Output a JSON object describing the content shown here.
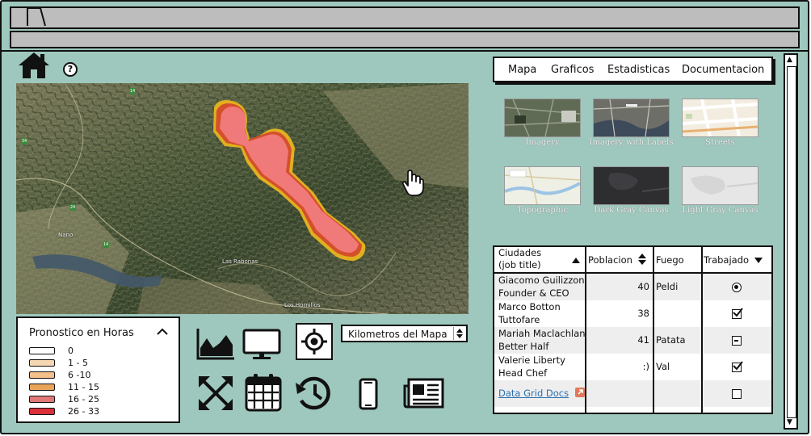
{
  "toolbar": {
    "help_label": "?"
  },
  "map": {
    "places": {
      "nano": "Nano",
      "las_rabonas": "Las Rabonas",
      "los_hornillos": "Los Hornillos"
    },
    "routes": {
      "r34": "34",
      "r14a": "14",
      "r14b": "14",
      "r24": "24"
    }
  },
  "legend": {
    "title": "Pronostico en Horas",
    "items": [
      {
        "label": "0",
        "color": "#ffffff"
      },
      {
        "label": "1 - 5",
        "color": "#f6d7b4"
      },
      {
        "label": "6 -10",
        "color": "#f4c08a"
      },
      {
        "label": "11 - 15",
        "color": "#e8a55a"
      },
      {
        "label": "16 - 25",
        "color": "#e07878"
      },
      {
        "label": "26 - 33",
        "color": "#d9303a"
      }
    ]
  },
  "units": {
    "selected": "Kilometros del Mapa"
  },
  "menu": {
    "items": [
      "Mapa",
      "Graficos",
      "Estadisticas",
      "Documentacion"
    ]
  },
  "basemaps": [
    {
      "label": "Imagery"
    },
    {
      "label": "Imagery with Labels"
    },
    {
      "label": "Streets"
    },
    {
      "label": "Topographic"
    },
    {
      "label": "Dark Gray Canvas"
    },
    {
      "label": "Light Gray Canvas"
    }
  ],
  "grid": {
    "headers": {
      "ciudades": "Ciudades\n(job title)",
      "poblacion": "Poblacion",
      "fuego": "Fuego",
      "trabajado": "Trabajado"
    },
    "rows": [
      {
        "name": "Giacomo Guilizzoni",
        "title": "Founder & CEO",
        "poblacion": "40",
        "fuego": "Peldi",
        "trabajado": "radio-selected"
      },
      {
        "name": "Marco Botton",
        "title": "Tuttofare",
        "poblacion": "38",
        "fuego": "",
        "trabajado": "checked"
      },
      {
        "name": "Mariah Maclachlan",
        "title": "Better Half",
        "poblacion": "41",
        "fuego": "Patata",
        "trabajado": "indeterminate"
      },
      {
        "name": "Valerie Liberty",
        "title": "Head Chef",
        "poblacion": ":)",
        "fuego": "Val",
        "trabajado": "checked"
      },
      {
        "name": "Data Grid Docs",
        "title": "",
        "poblacion": "",
        "fuego": "",
        "trabajado": "unchecked"
      }
    ]
  },
  "colors": {
    "background": "#9ec8bd",
    "fire_core": "#f07a7a",
    "fire_edge": "#e0b020",
    "link": "#2a6fb0"
  }
}
